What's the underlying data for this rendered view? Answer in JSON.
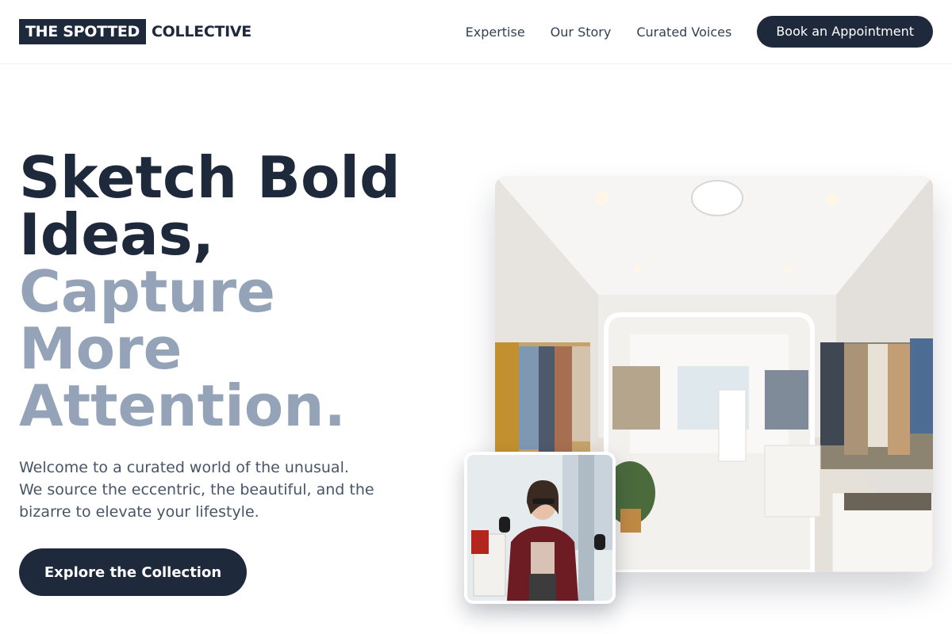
{
  "header": {
    "logo_box": "THE SPOTTED",
    "logo_rest": "COLLECTIVE",
    "nav": [
      "Expertise",
      "Our Story",
      "Curated Voices"
    ],
    "cta": "Book an Appointment"
  },
  "hero": {
    "title_dark_1": "Sketch Bold",
    "title_dark_2": "Ideas,",
    "title_light_1": "Capture",
    "title_light_2": "More",
    "title_light_3": "Attention.",
    "description": "Welcome to a curated world of the unusual. We source the eccentric, the beautiful, and the bizarre to elevate your lifestyle.",
    "button": "Explore the Collection"
  },
  "colors": {
    "primary": "#1e293b",
    "muted_heading": "#94a3b8",
    "body_text": "#475569"
  }
}
